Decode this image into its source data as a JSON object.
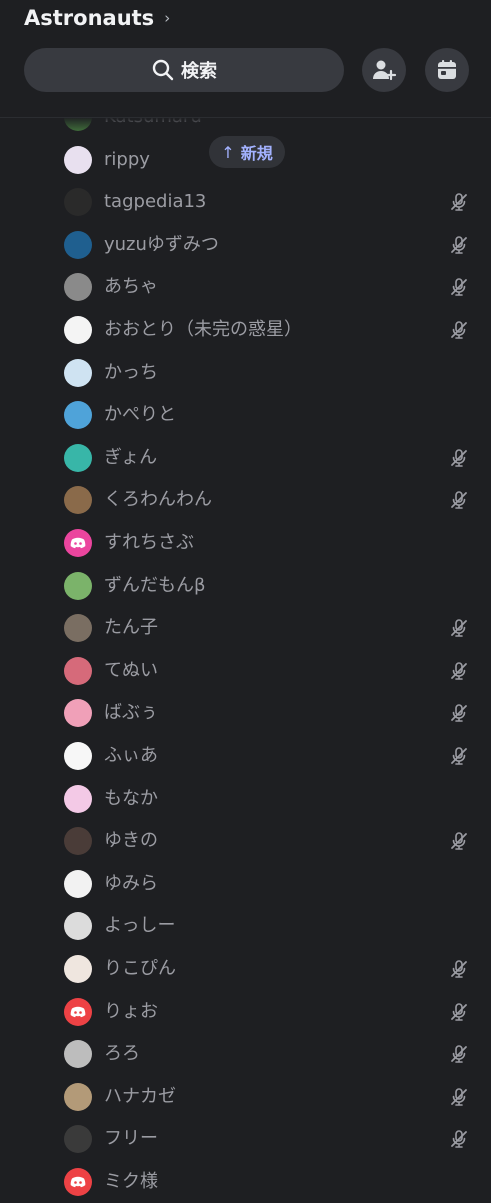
{
  "header": {
    "server_name": "Astronauts",
    "chevron": "›",
    "search_label": "検索",
    "icons": [
      "search-icon",
      "add-member-icon",
      "calendar-icon"
    ]
  },
  "new_pill": {
    "arrow": "↑",
    "label": "新規"
  },
  "members": [
    {
      "name": "Katsumaru",
      "muted": false,
      "avatar_color": "#3f6b3a"
    },
    {
      "name": "rippy",
      "muted": false,
      "avatar_color": "#e8e0ef"
    },
    {
      "name": "tagpedia13",
      "muted": true,
      "avatar_color": "#2a2a2a"
    },
    {
      "name": "yuzuゆずみつ",
      "muted": true,
      "avatar_color": "#1f5f8f"
    },
    {
      "name": "あちゃ",
      "muted": true,
      "avatar_color": "#8a8a8a"
    },
    {
      "name": "おおとり（未完の惑星）",
      "muted": true,
      "avatar_color": "#f4f4f4"
    },
    {
      "name": "かっち",
      "muted": false,
      "avatar_color": "#cfe3f2"
    },
    {
      "name": "かぺりと",
      "muted": false,
      "avatar_color": "#4fa3d9"
    },
    {
      "name": "ぎょん",
      "muted": true,
      "avatar_color": "#38b6a8"
    },
    {
      "name": "くろわんわん",
      "muted": true,
      "avatar_color": "#8a6a4a"
    },
    {
      "name": "すれちさぶ",
      "muted": false,
      "avatar_color": "#eb459e",
      "discord": true
    },
    {
      "name": "ずんだもんβ",
      "muted": false,
      "avatar_color": "#7bb36a"
    },
    {
      "name": "たん子",
      "muted": true,
      "avatar_color": "#7a6e62"
    },
    {
      "name": "てぬい",
      "muted": true,
      "avatar_color": "#d66a7a"
    },
    {
      "name": "ばぶぅ",
      "muted": true,
      "avatar_color": "#f0a0b8"
    },
    {
      "name": "ふぃあ",
      "muted": true,
      "avatar_color": "#f7f7f7"
    },
    {
      "name": "もなか",
      "muted": false,
      "avatar_color": "#f3c9e6"
    },
    {
      "name": "ゆきの",
      "muted": true,
      "avatar_color": "#4a3c38"
    },
    {
      "name": "ゆみら",
      "muted": false,
      "avatar_color": "#f2f2f2"
    },
    {
      "name": "よっしー",
      "muted": false,
      "avatar_color": "#dcdcdc"
    },
    {
      "name": "りこぴん",
      "muted": true,
      "avatar_color": "#efe6df"
    },
    {
      "name": "りょお",
      "muted": true,
      "avatar_color": "#ed4245",
      "discord": true
    },
    {
      "name": "ろろ",
      "muted": true,
      "avatar_color": "#bdbdbd"
    },
    {
      "name": "ハナカゼ",
      "muted": true,
      "avatar_color": "#b39a78"
    },
    {
      "name": "フリー",
      "muted": true,
      "avatar_color": "#3a3a3a"
    },
    {
      "name": "ミク様",
      "muted": false,
      "avatar_color": "#ed4245",
      "discord": true
    }
  ]
}
